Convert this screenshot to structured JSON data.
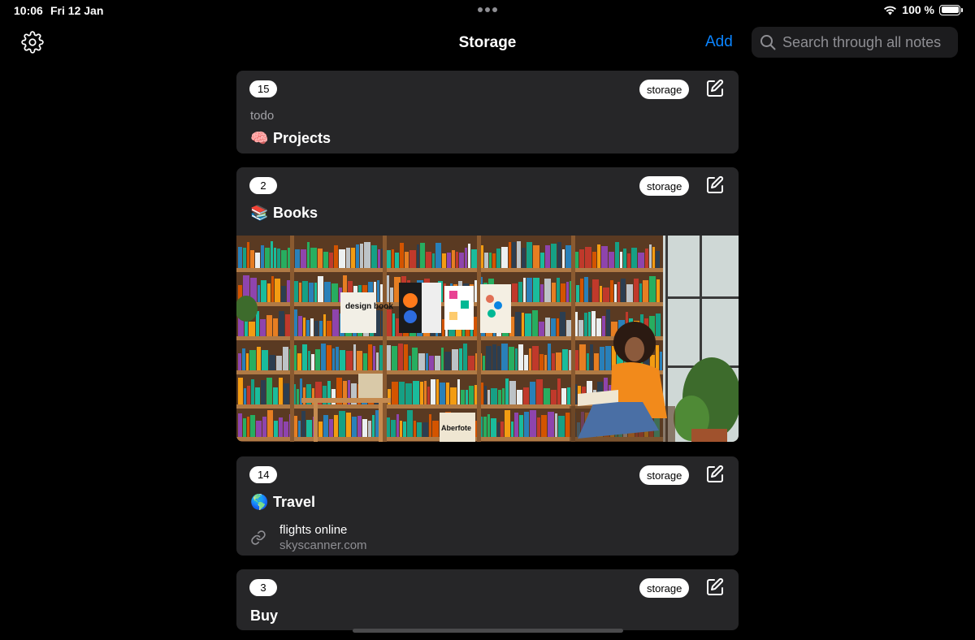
{
  "status_bar": {
    "time": "10:06",
    "date": "Fri 12 Jan",
    "battery": "100 %",
    "battery_level": 1.0
  },
  "nav": {
    "title": "Storage",
    "add_label": "Add",
    "search_placeholder": "Search through all notes"
  },
  "cards": [
    {
      "count": "15",
      "tag": "storage",
      "subtitle": "todo",
      "emoji": "🧠",
      "title": "Projects"
    },
    {
      "count": "2",
      "tag": "storage",
      "emoji": "📚",
      "title": "Books"
    },
    {
      "count": "14",
      "tag": "storage",
      "emoji": "🌎",
      "title": "Travel",
      "link": {
        "title": "flights online",
        "domain": "skyscanner.com"
      }
    },
    {
      "count": "3",
      "tag": "storage",
      "title": "Buy"
    }
  ],
  "book_image": {
    "sign1": "design book",
    "sign2": "Aberfote"
  },
  "colors": {
    "accent": "#0a84ff",
    "card_bg": "#262628",
    "background": "#000000"
  },
  "icons": [
    "gear-icon",
    "search-icon",
    "edit-icon",
    "link-icon",
    "wifi-icon",
    "battery-icon"
  ]
}
